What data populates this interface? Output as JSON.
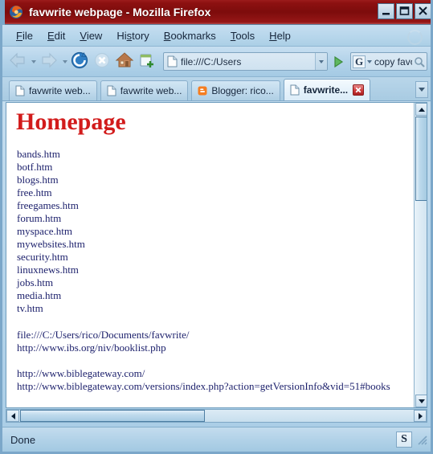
{
  "window": {
    "title": "favwrite webpage - Mozilla Firefox",
    "logo_icon": "firefox-logo-icon",
    "minimize_label": "Minimize",
    "maximize_label": "Maximize",
    "close_label": "Close"
  },
  "menubar": {
    "items": [
      {
        "label": "File",
        "accesskey": "F"
      },
      {
        "label": "Edit",
        "accesskey": "E"
      },
      {
        "label": "View",
        "accesskey": "V"
      },
      {
        "label": "History",
        "accesskey": "s"
      },
      {
        "label": "Bookmarks",
        "accesskey": "B"
      },
      {
        "label": "Tools",
        "accesskey": "T"
      },
      {
        "label": "Help",
        "accesskey": "H"
      }
    ]
  },
  "toolbar": {
    "back_icon": "back-arrow-icon",
    "forward_icon": "forward-arrow-icon",
    "reload_icon": "reload-icon",
    "stop_icon": "stop-icon",
    "home_icon": "home-icon",
    "newtab_icon": "new-page-icon",
    "address": {
      "value": "file:///C:/Users",
      "favicon": "page-favicon",
      "dropdown_icon": "chevron-down-icon"
    },
    "go_icon": "go-arrow-icon",
    "search": {
      "engine_letter": "G",
      "engine_name": "Google",
      "value": "copy favo",
      "magnifier_icon": "magnifier-icon"
    }
  },
  "tabs": [
    {
      "label": "favwrite web...",
      "favicon": "page-favicon",
      "active": false
    },
    {
      "label": "favwrite web...",
      "favicon": "page-favicon",
      "active": false
    },
    {
      "label": "Blogger: rico...",
      "favicon": "blogger-icon",
      "active": false
    },
    {
      "label": "favwrite...",
      "favicon": "page-favicon",
      "active": true
    }
  ],
  "tab_list_icon": "tab-list-chevron-icon",
  "page": {
    "heading": "Homepage",
    "heading_color": "#d21b1b",
    "link_color": "#1b1f6b",
    "links": [
      "bands.htm",
      "botf.htm",
      "blogs.htm",
      "free.htm",
      "freegames.htm",
      "forum.htm",
      "myspace.htm",
      "mywebsites.htm",
      "security.htm",
      "linuxnews.htm",
      "jobs.htm",
      "media.htm",
      "tv.htm"
    ],
    "url_group_1": [
      "file:///C:/Users/rico/Documents/favwrite/",
      "http://www.ibs.org/niv/booklist.php"
    ],
    "url_group_2": [
      "http://www.biblegateway.com/",
      "http://www.biblegateway.com/versions/index.php?action=getVersionInfo&vid=51#books"
    ]
  },
  "scrollbars": {
    "vertical_up_icon": "scroll-up-icon",
    "vertical_down_icon": "scroll-down-icon",
    "horizontal_left_icon": "scroll-left-icon",
    "horizontal_right_icon": "scroll-right-icon"
  },
  "statusbar": {
    "text": "Done",
    "tray_letter": "S",
    "tray_icon": "stumbleupon-icon",
    "resize_icon": "resize-grip-icon"
  }
}
